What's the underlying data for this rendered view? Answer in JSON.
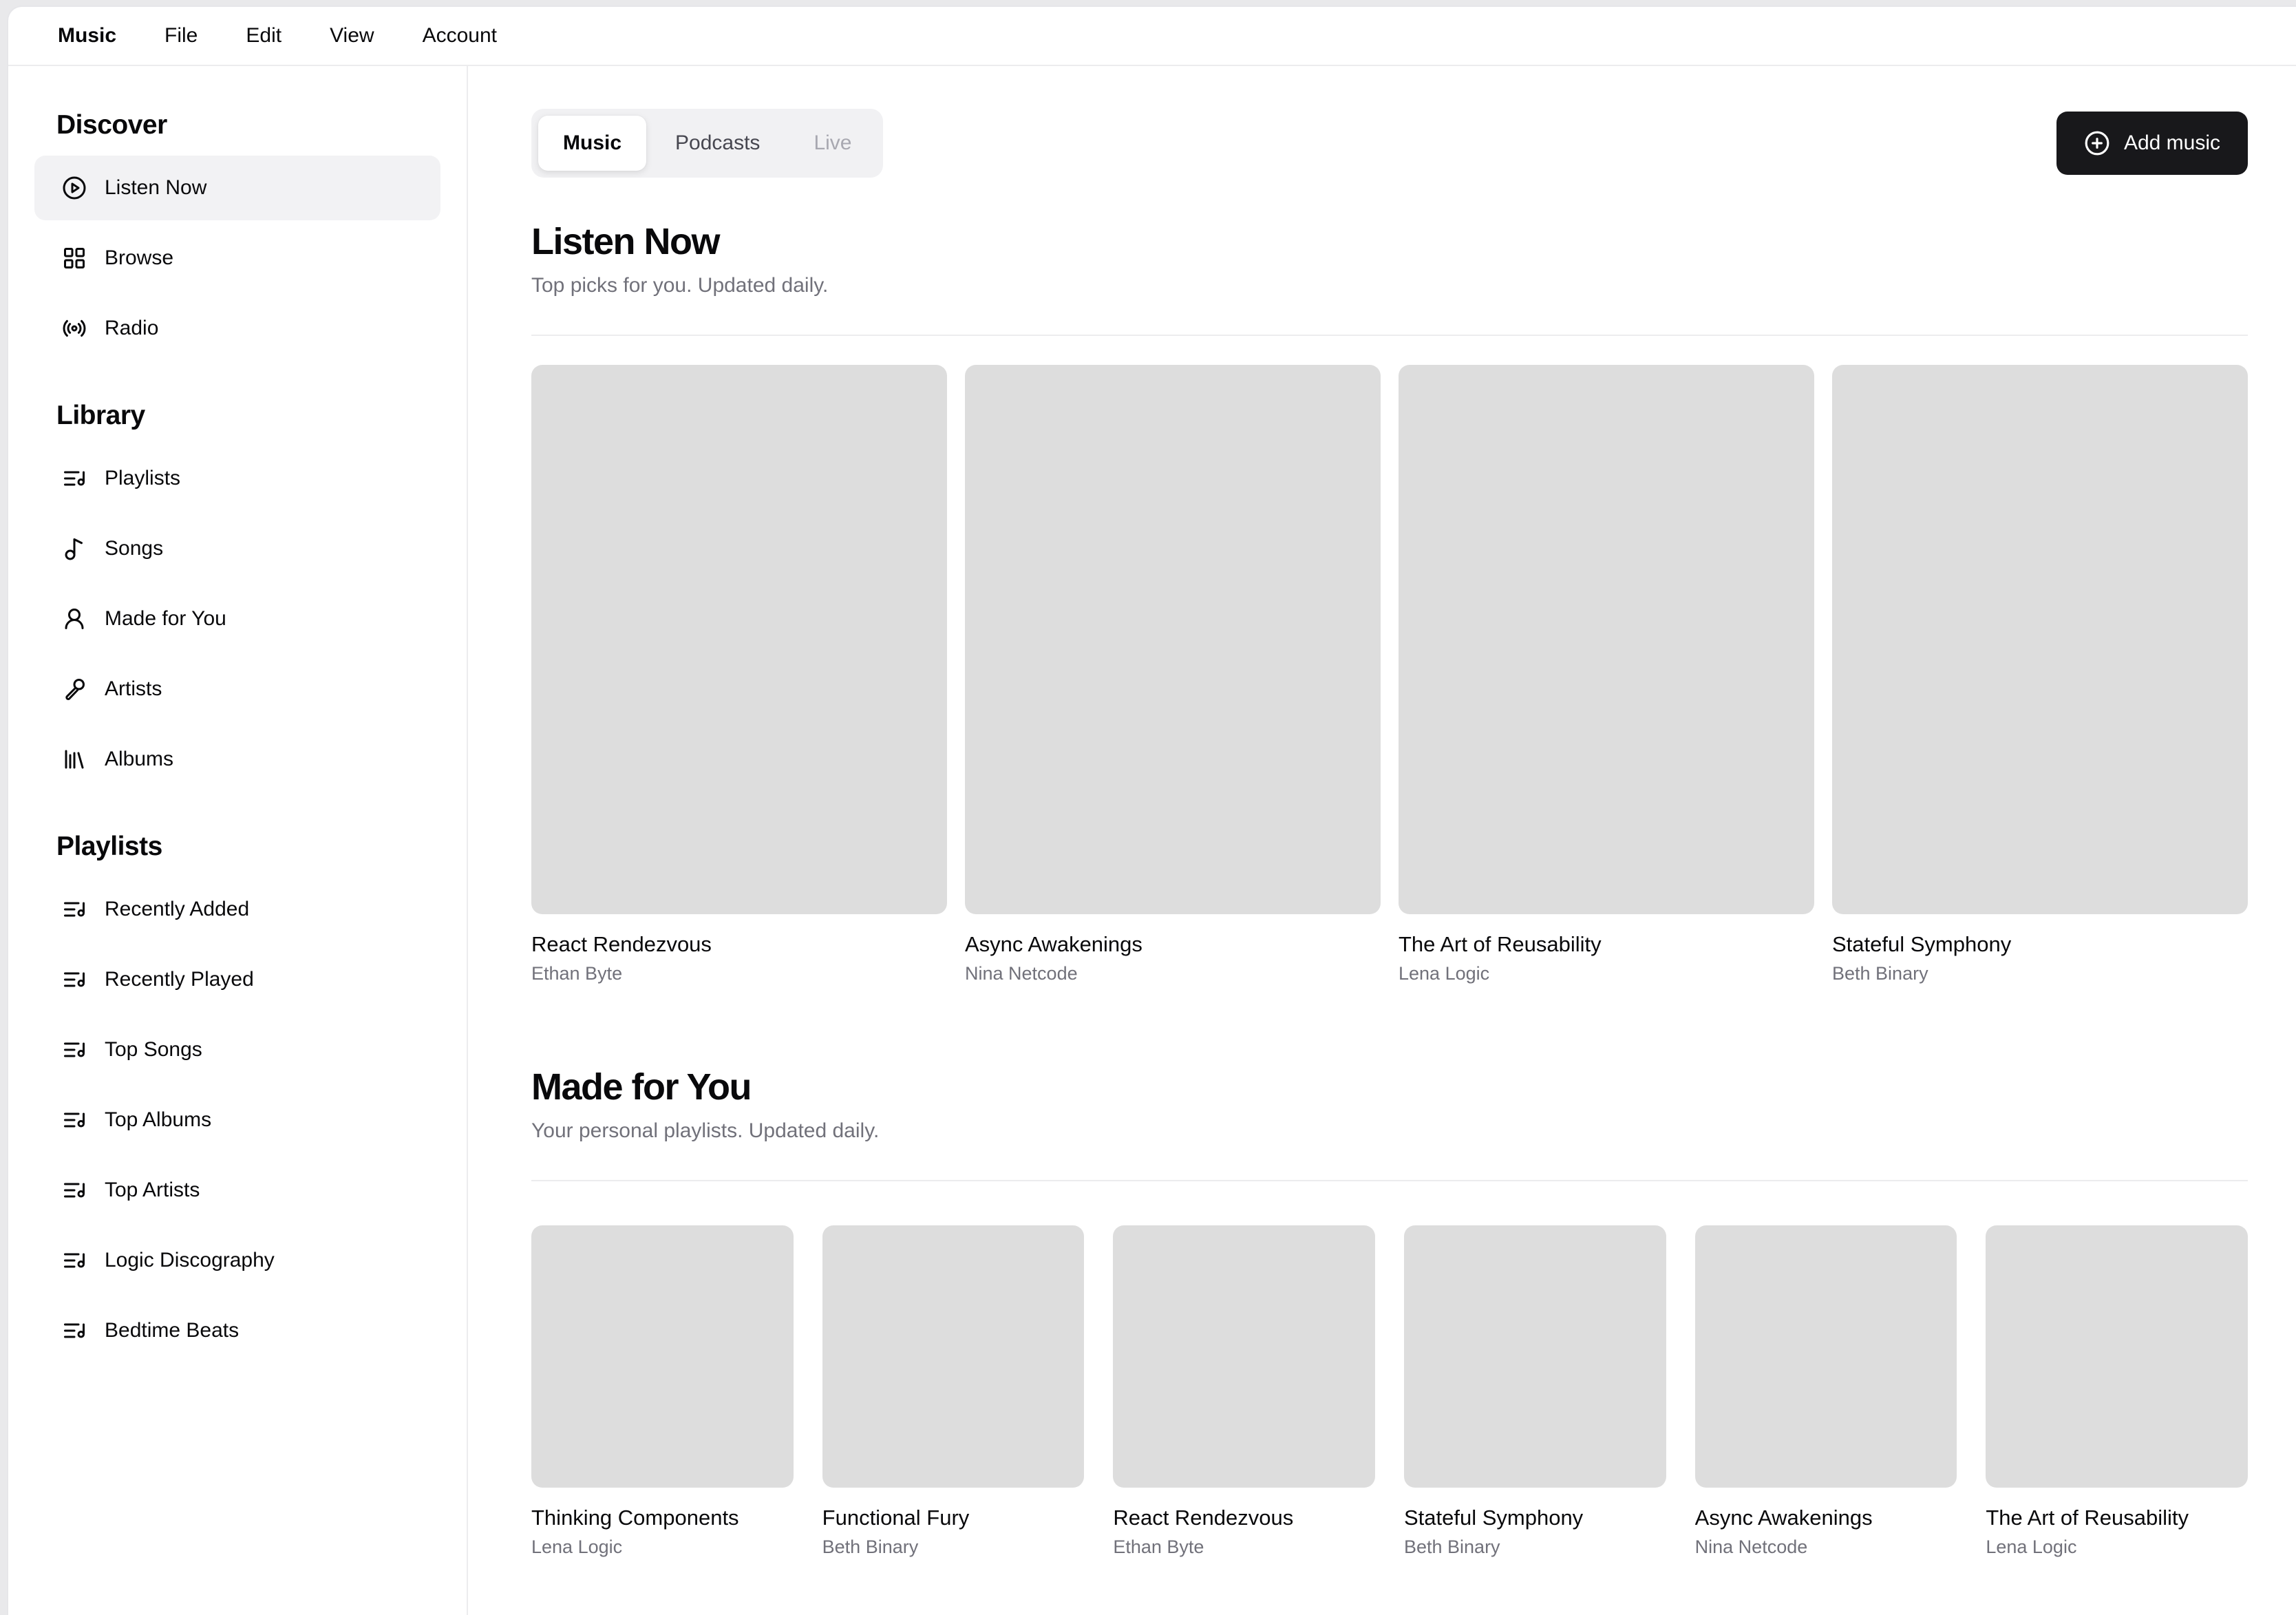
{
  "menubar": {
    "items": [
      {
        "label": "Music",
        "active": true
      },
      {
        "label": "File",
        "active": false
      },
      {
        "label": "Edit",
        "active": false
      },
      {
        "label": "View",
        "active": false
      },
      {
        "label": "Account",
        "active": false
      }
    ]
  },
  "sidebar": {
    "sections": [
      {
        "title": "Discover",
        "items": [
          {
            "label": "Listen Now",
            "icon": "play-circle-icon",
            "active": true
          },
          {
            "label": "Browse",
            "icon": "layout-grid-icon",
            "active": false
          },
          {
            "label": "Radio",
            "icon": "radio-icon",
            "active": false
          }
        ]
      },
      {
        "title": "Library",
        "items": [
          {
            "label": "Playlists",
            "icon": "list-music-icon",
            "active": false
          },
          {
            "label": "Songs",
            "icon": "music-note-icon",
            "active": false
          },
          {
            "label": "Made for You",
            "icon": "user-icon",
            "active": false
          },
          {
            "label": "Artists",
            "icon": "microphone-icon",
            "active": false
          },
          {
            "label": "Albums",
            "icon": "library-icon",
            "active": false
          }
        ]
      },
      {
        "title": "Playlists",
        "items": [
          {
            "label": "Recently Added",
            "icon": "list-music-icon",
            "active": false
          },
          {
            "label": "Recently Played",
            "icon": "list-music-icon",
            "active": false
          },
          {
            "label": "Top Songs",
            "icon": "list-music-icon",
            "active": false
          },
          {
            "label": "Top Albums",
            "icon": "list-music-icon",
            "active": false
          },
          {
            "label": "Top Artists",
            "icon": "list-music-icon",
            "active": false
          },
          {
            "label": "Logic Discography",
            "icon": "list-music-icon",
            "active": false
          },
          {
            "label": "Bedtime Beats",
            "icon": "list-music-icon",
            "active": false
          }
        ]
      }
    ]
  },
  "main": {
    "tabs": [
      {
        "label": "Music",
        "active": true,
        "disabled": false
      },
      {
        "label": "Podcasts",
        "active": false,
        "disabled": false
      },
      {
        "label": "Live",
        "active": false,
        "disabled": true
      }
    ],
    "add_music_label": "Add music",
    "add_music_icon": "plus-circle-icon",
    "sections": [
      {
        "title": "Listen Now",
        "subtitle": "Top picks for you. Updated daily.",
        "layout": "portrait",
        "albums": [
          {
            "title": "React Rendezvous",
            "artist": "Ethan Byte",
            "image": "woman-headphones-bookshelf"
          },
          {
            "title": "Async Awakenings",
            "artist": "Nina Netcode",
            "image": "blonde-woman-window-reflection"
          },
          {
            "title": "The Art of Reusability",
            "artist": "Lena Logic",
            "image": "saxophonist-street"
          },
          {
            "title": "Stateful Symphony",
            "artist": "Beth Binary",
            "image": "guitarist-stone-steps"
          }
        ]
      },
      {
        "title": "Made for You",
        "subtitle": "Your personal playlists. Updated daily.",
        "layout": "square",
        "albums": [
          {
            "title": "Thinking Components",
            "artist": "Lena Logic",
            "image": "duo-white-outfits-marina"
          },
          {
            "title": "Functional Fury",
            "artist": "Beth Binary",
            "image": "pianist-record-room"
          },
          {
            "title": "React Rendezvous",
            "artist": "Ethan Byte",
            "image": "woman-headphones-bookshelf"
          },
          {
            "title": "Stateful Symphony",
            "artist": "Beth Binary",
            "image": "bw-woman-chair-trumpet"
          },
          {
            "title": "Async Awakenings",
            "artist": "Nina Netcode",
            "image": "blonde-woman-window-reflection"
          },
          {
            "title": "The Art of Reusability",
            "artist": "Lena Logic",
            "image": "guitarist-stone-steps"
          }
        ]
      }
    ]
  },
  "colors": {
    "page_backdrop": "#e9e9eb",
    "surface": "#ffffff",
    "text_primary": "#09090b",
    "text_muted": "#71717a",
    "border": "#ececee",
    "accent_button": "#18181b",
    "active_item_bg": "#f2f2f4"
  }
}
